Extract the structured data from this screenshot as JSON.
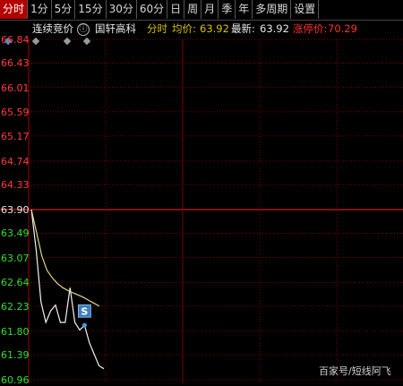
{
  "toolbar": {
    "tabs": [
      "分时",
      "1分",
      "5分",
      "15分",
      "30分",
      "60分",
      "日",
      "周",
      "月",
      "季",
      "年",
      "多周期",
      "设置"
    ],
    "active_index": 0
  },
  "info": {
    "mode": "连续竞价",
    "info_icon": "ⓘ",
    "stock_name": "国轩高科",
    "view_label": "分时",
    "avg_label": "均价:",
    "avg_value": "63.92",
    "last_label": "最新:",
    "last_value": "63.92",
    "limit_label": "涨停价:",
    "limit_value": "70.29"
  },
  "y_axis": {
    "labels": [
      "66.84",
      "66.43",
      "66.01",
      "65.59",
      "65.17",
      "64.74",
      "64.33",
      "63.90",
      "63.49",
      "63.07",
      "62.64",
      "62.23",
      "61.80",
      "61.39",
      "60.96"
    ],
    "reference": "63.90"
  },
  "marker": {
    "text": "S"
  },
  "watermark": "百家号/短线阿飞",
  "colors": {
    "up": "#ff3c3c",
    "down": "#2ee02e",
    "price_line": "#f2f2f2",
    "avg_line": "#e2d58a",
    "grid": "#7a0000"
  },
  "chart_data": {
    "type": "line",
    "ylim": [
      60.96,
      66.84
    ],
    "series": [
      {
        "name": "price",
        "values": [
          63.9,
          63.2,
          62.3,
          61.95,
          62.15,
          62.25,
          61.95,
          61.95,
          62.55,
          61.95,
          61.82,
          61.9,
          61.6,
          61.4,
          61.2,
          61.15
        ]
      },
      {
        "name": "avg",
        "values": [
          63.9,
          63.5,
          63.1,
          62.85,
          62.72,
          62.62,
          62.55,
          62.5,
          62.46,
          62.42,
          62.38,
          62.33,
          62.28,
          62.23
        ]
      }
    ],
    "annotations": [
      {
        "text": "S",
        "index": 11
      }
    ]
  }
}
